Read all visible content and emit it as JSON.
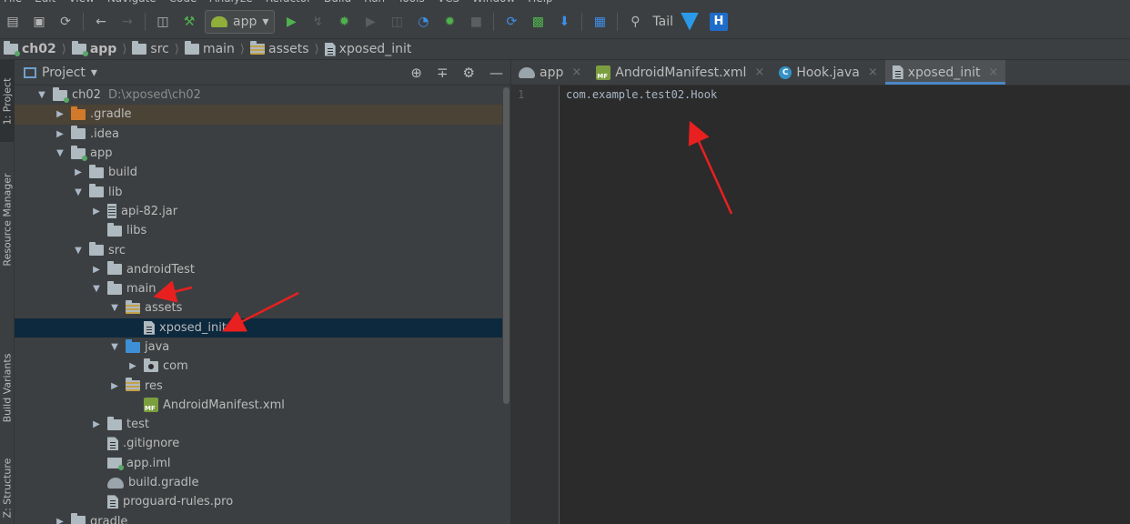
{
  "menubar": [
    "File",
    "Edit",
    "View",
    "Navigate",
    "Code",
    "Analyze",
    "Refactor",
    "Build",
    "Run",
    "Tools",
    "VCS",
    "Window",
    "Help"
  ],
  "toolbar": {
    "run_config": "app",
    "tail_label": "Tail",
    "h_badge": "H",
    "icons": [
      "open-icon",
      "save-icon",
      "sync-icon",
      "back-icon",
      "forward-icon",
      "terminal-icon",
      "build-hammer-icon",
      "run-icon",
      "apply-changes-icon",
      "debug-icon",
      "profile-icon",
      "attach-debugger-icon",
      "stop-icon",
      "gradle-sync-icon",
      "avd-manager-icon",
      "sdk-manager-icon",
      "project-structure-icon",
      "search-icon"
    ]
  },
  "breadcrumb": [
    {
      "label": "ch02",
      "bold": true,
      "icon": "module-folder-icon"
    },
    {
      "label": "app",
      "bold": true,
      "icon": "module-folder-icon"
    },
    {
      "label": "src",
      "bold": false,
      "icon": "folder-icon"
    },
    {
      "label": "main",
      "bold": false,
      "icon": "folder-icon"
    },
    {
      "label": "assets",
      "bold": false,
      "icon": "assets-folder-icon"
    },
    {
      "label": "xposed_init",
      "bold": false,
      "icon": "file-icon"
    }
  ],
  "side_tabs": {
    "project": "1: Project",
    "resource_manager": "Resource Manager",
    "build_variants": "Build Variants",
    "structure": "Z: Structure"
  },
  "project_panel": {
    "title": "Project",
    "tree": [
      {
        "label": "ch02",
        "path": "D:\\xposed\\ch02",
        "depth": 0,
        "caret": "down",
        "icon": "module"
      },
      {
        "label": ".gradle",
        "depth": 1,
        "caret": "right",
        "icon": "orange",
        "highlight": true
      },
      {
        "label": ".idea",
        "depth": 1,
        "caret": "right",
        "icon": "folder"
      },
      {
        "label": "app",
        "depth": 1,
        "caret": "down",
        "icon": "module"
      },
      {
        "label": "build",
        "depth": 2,
        "caret": "right",
        "icon": "folder"
      },
      {
        "label": "lib",
        "depth": 2,
        "caret": "down",
        "icon": "folder"
      },
      {
        "label": "api-82.jar",
        "depth": 3,
        "caret": "right",
        "icon": "jar"
      },
      {
        "label": "libs",
        "depth": 3,
        "caret": "none",
        "icon": "folder"
      },
      {
        "label": "src",
        "depth": 2,
        "caret": "down",
        "icon": "folder"
      },
      {
        "label": "androidTest",
        "depth": 3,
        "caret": "right",
        "icon": "folder"
      },
      {
        "label": "main",
        "depth": 3,
        "caret": "down",
        "icon": "folder"
      },
      {
        "label": "assets",
        "depth": 4,
        "caret": "down",
        "icon": "striped"
      },
      {
        "label": "xposed_init",
        "depth": 5,
        "caret": "none",
        "icon": "file",
        "selected": true
      },
      {
        "label": "java",
        "depth": 4,
        "caret": "down",
        "icon": "blue"
      },
      {
        "label": "com",
        "depth": 5,
        "caret": "right",
        "icon": "pkg"
      },
      {
        "label": "res",
        "depth": 4,
        "caret": "right",
        "icon": "striped"
      },
      {
        "label": "AndroidManifest.xml",
        "depth": 5,
        "caret": "none",
        "icon": "xml"
      },
      {
        "label": "test",
        "depth": 3,
        "caret": "right",
        "icon": "folder"
      },
      {
        "label": ".gitignore",
        "depth": 3,
        "caret": "none",
        "icon": "file"
      },
      {
        "label": "app.iml",
        "depth": 3,
        "caret": "none",
        "icon": "iml"
      },
      {
        "label": "build.gradle",
        "depth": 3,
        "caret": "none",
        "icon": "gradle"
      },
      {
        "label": "proguard-rules.pro",
        "depth": 3,
        "caret": "none",
        "icon": "file"
      },
      {
        "label": "gradle",
        "depth": 1,
        "caret": "right",
        "icon": "folder"
      }
    ]
  },
  "editor": {
    "tabs": [
      {
        "label": "app",
        "icon": "gradle-icon",
        "active": false
      },
      {
        "label": "AndroidManifest.xml",
        "icon": "manifest-icon",
        "active": false
      },
      {
        "label": "Hook.java",
        "icon": "class-icon",
        "active": false
      },
      {
        "label": "xposed_init",
        "icon": "file-icon",
        "active": true
      }
    ],
    "line_numbers": [
      "1"
    ],
    "lines": [
      "com.example.test02.Hook"
    ]
  },
  "annotation_color": "#e8201f"
}
